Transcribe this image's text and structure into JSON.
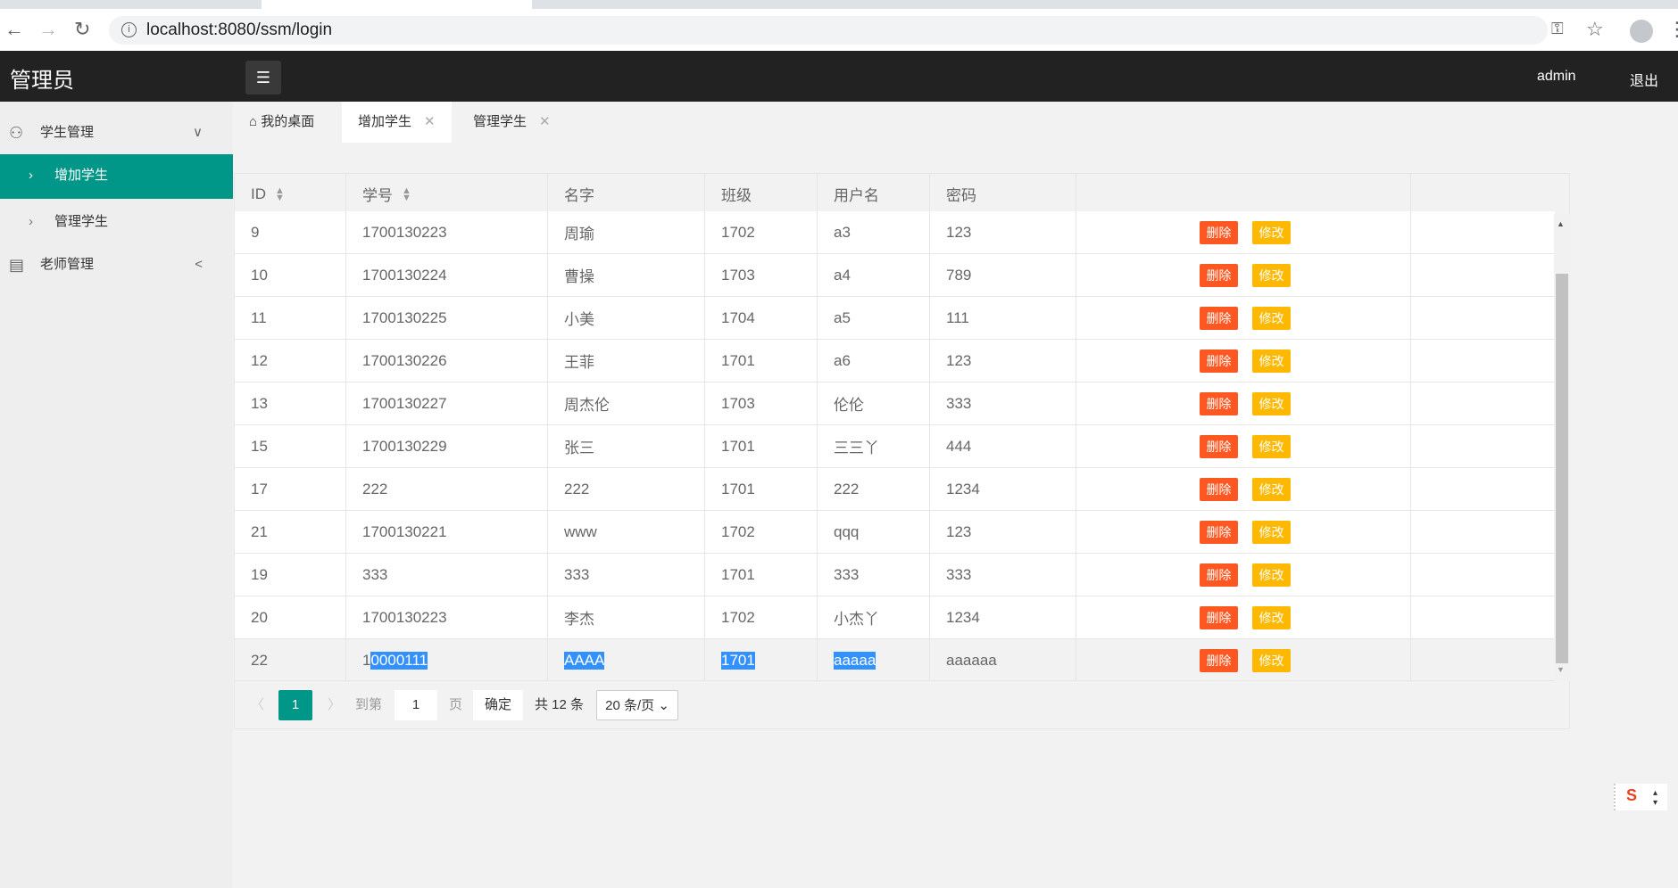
{
  "browser": {
    "url": "localhost:8080/ssm/login"
  },
  "header": {
    "title": "管理员",
    "user": "admin",
    "logout": "退出"
  },
  "sidebar": {
    "items": [
      {
        "label": "学生管理",
        "icon": "user-icon"
      },
      {
        "label": "增加学生",
        "active": true
      },
      {
        "label": "管理学生"
      },
      {
        "label": "老师管理",
        "icon": "document-icon"
      }
    ]
  },
  "tabs": [
    {
      "label": "我的桌面"
    },
    {
      "label": "增加学生",
      "close": "✕"
    },
    {
      "label": "管理学生",
      "close": "✕"
    }
  ],
  "table": {
    "columns": [
      "ID",
      "学号",
      "名字",
      "班级",
      "用户名",
      "密码"
    ],
    "actions": {
      "delete": "删除",
      "edit": "修改"
    },
    "rows": [
      [
        "9",
        "1700130223",
        "周瑜",
        "1702",
        "a3",
        "123"
      ],
      [
        "10",
        "1700130224",
        "曹操",
        "1703",
        "a4",
        "789"
      ],
      [
        "11",
        "1700130225",
        "小美",
        "1704",
        "a5",
        "111"
      ],
      [
        "12",
        "1700130226",
        "王菲",
        "1701",
        "a6",
        "123"
      ],
      [
        "13",
        "1700130227",
        "周杰伦",
        "1703",
        "伦伦",
        "333"
      ],
      [
        "15",
        "1700130229",
        "张三",
        "1701",
        "三三丫",
        "444"
      ],
      [
        "17",
        "222",
        "222",
        "1701",
        "222",
        "1234"
      ],
      [
        "21",
        "1700130221",
        "www",
        "1702",
        "qqq",
        "123"
      ],
      [
        "19",
        "333",
        "333",
        "1701",
        "333",
        "333"
      ],
      [
        "20",
        "1700130223",
        "李杰",
        "1702",
        "小杰丫",
        "1234"
      ]
    ],
    "last_row": {
      "id": "22",
      "sno_prefix": "1",
      "sno_selected": "0000111",
      "name": "AAAA",
      "class": "1701",
      "username": "aaaaa",
      "password": "aaaaaa"
    }
  },
  "pagination": {
    "current": "1",
    "goto_label": "到第",
    "goto_value": "1",
    "page_label": "页",
    "confirm": "确定",
    "total": "共 12 条",
    "page_size": "20 条/页"
  },
  "colors": {
    "accent": "#009688",
    "delete": "#ff5722",
    "edit": "#ffb800",
    "header": "#222222"
  }
}
